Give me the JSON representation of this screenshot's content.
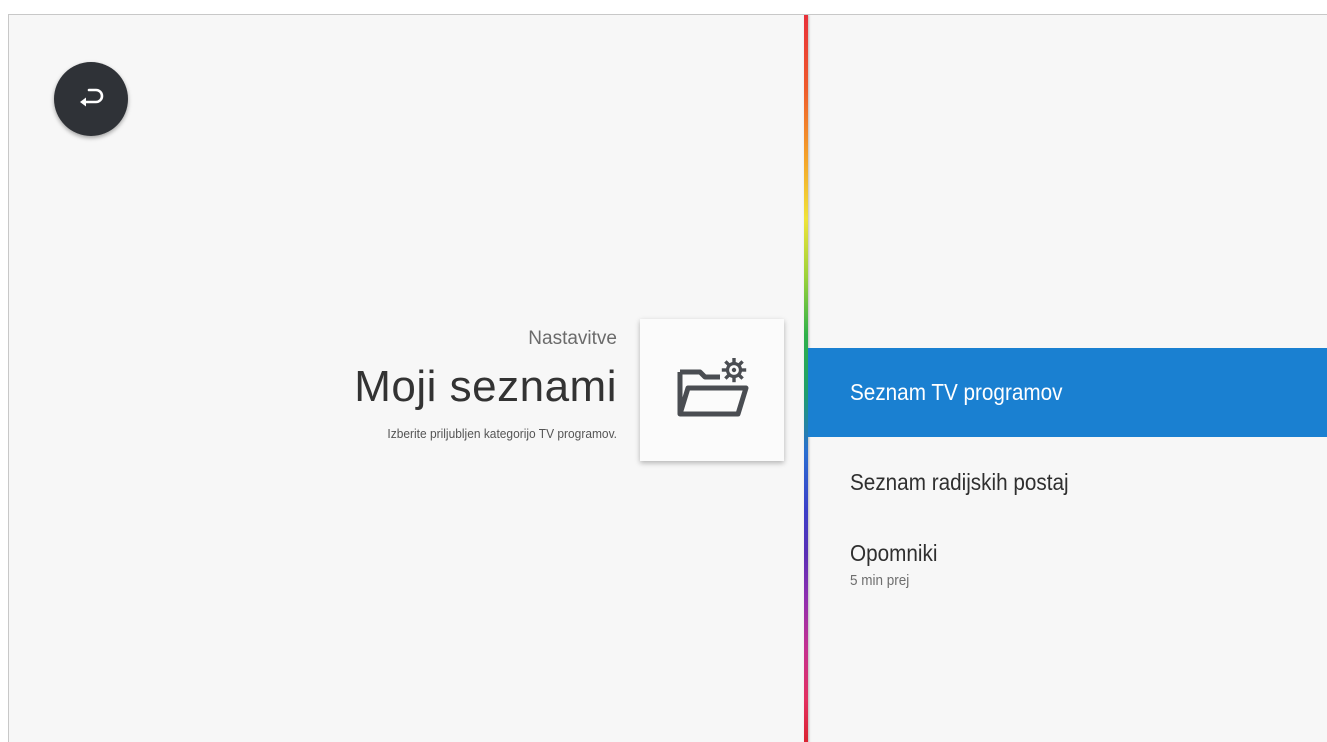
{
  "back_button": {
    "icon": "back-arrow-icon",
    "background": "#2f3237"
  },
  "header": {
    "breadcrumb": "Nastavitve",
    "title": "Moji seznami",
    "subtitle": "Izberite priljubljen kategorijo TV programov."
  },
  "folder_card": {
    "icon": "folder-settings-icon"
  },
  "menu": {
    "items": [
      {
        "label": "Seznam TV programov",
        "selected": true
      },
      {
        "label": "Seznam radijskih postaj"
      },
      {
        "label": "Opomniki",
        "sublabel": "5 min prej"
      }
    ],
    "accent_color": "#1a80d1"
  }
}
